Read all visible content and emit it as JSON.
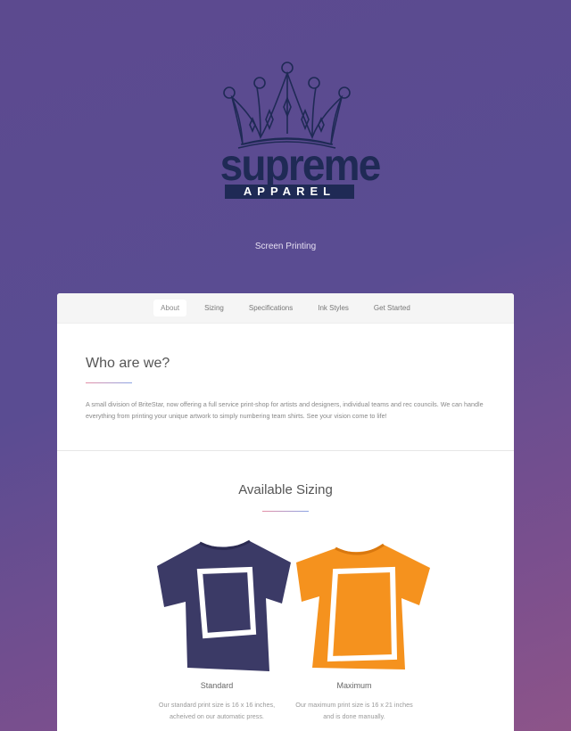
{
  "brand": {
    "logo_main": "supreme",
    "logo_sub": "APPAREL",
    "tagline": "Screen Printing"
  },
  "nav": {
    "items": [
      {
        "label": "About",
        "active": true
      },
      {
        "label": "Sizing",
        "active": false
      },
      {
        "label": "Specifications",
        "active": false
      },
      {
        "label": "Ink Styles",
        "active": false
      },
      {
        "label": "Get Started",
        "active": false
      }
    ]
  },
  "about": {
    "title": "Who are we?",
    "text": "A small division of BriteStar, now offering a full service print-shop for artists and designers, individual teams and rec councils. We can handle everything from printing your unique artwork to simply numbering team shirts. See your vision come to life!"
  },
  "sizing": {
    "title": "Available Sizing",
    "options": [
      {
        "label": "Standard",
        "desc_line1": "Our standard print size is 16 x 16 inches,",
        "desc_line2": "acheived on our automatic press.",
        "color": "#3b3a66"
      },
      {
        "label": "Maximum",
        "desc_line1": "Our maximum print size is 16 x 21 inches",
        "desc_line2": "and is done manually.",
        "color": "#f5921e"
      }
    ]
  },
  "colors": {
    "logo_navy": "#1f2a55",
    "accent_pink": "#e58fa6",
    "accent_blue": "#8aa3e4"
  }
}
